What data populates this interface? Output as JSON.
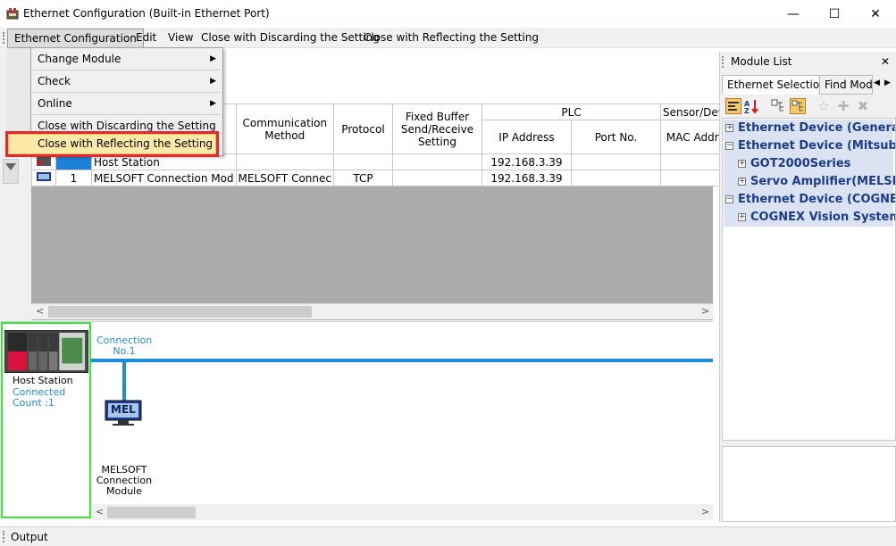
{
  "window": {
    "title": "Ethernet Configuration (Built-in Ethernet Port)",
    "minimize": "—",
    "maximize": "☐",
    "close": "✕"
  },
  "menu": {
    "items": [
      "Ethernet Configuration",
      "Edit",
      "View",
      "Close with Discarding the Setting",
      "Close with Reflecting the Setting"
    ]
  },
  "dropdown": {
    "items": [
      {
        "label": "Change Module",
        "submenu": true
      },
      {
        "label": "Check",
        "submenu": true
      },
      {
        "label": "Online",
        "submenu": true
      },
      {
        "label": "Close with Discarding the Setting",
        "submenu": false
      },
      {
        "label": "Close with Reflecting the Setting",
        "submenu": false
      }
    ],
    "arrow": "▶"
  },
  "grid": {
    "headers": {
      "comm_method": "Communication Method",
      "protocol": "Protocol",
      "fixed_buffer": "Fixed Buffer Send/Receive Setting",
      "plc": "PLC",
      "sensor": "Sensor/Device",
      "ip": "IP Address",
      "port": "Port No.",
      "mac": "MAC Address"
    },
    "rows": [
      {
        "no": "",
        "name": "Host Station",
        "method": "",
        "protocol": "",
        "fixed": "",
        "ip": "192.168.3.39",
        "port": "",
        "mac": ""
      },
      {
        "no": "1",
        "name": "MELSOFT Connection Mod",
        "method": "MELSOFT Connec",
        "protocol": "TCP",
        "fixed": "",
        "ip": "192.168.3.39",
        "port": "",
        "mac": ""
      }
    ]
  },
  "scroll": {
    "left": "<",
    "right": ">"
  },
  "diagram": {
    "connection_label": "Connection No.1",
    "host_label": "Host Station",
    "connected_count": "Connected Count :1",
    "module_label": "MELSOFT Connection Module",
    "mel_text": "MEL"
  },
  "module_list": {
    "title": "Module List",
    "close": "✕",
    "tabs": [
      "Ethernet Selection",
      "Find Mod"
    ],
    "tab_prev": "◀",
    "tab_next": "▶",
    "tree": [
      {
        "label": "Ethernet Device (General)",
        "level": 0,
        "expander": "+"
      },
      {
        "label": "Ethernet Device (Mitsubishi",
        "level": 0,
        "expander": "−"
      },
      {
        "label": "GOT2000Series",
        "level": 1,
        "expander": "+"
      },
      {
        "label": "Servo Amplifier(MELSERV",
        "level": 1,
        "expander": "+"
      },
      {
        "label": "Ethernet Device (COGNEX)",
        "level": 0,
        "expander": "−"
      },
      {
        "label": "COGNEX Vision System",
        "level": 1,
        "expander": "+"
      }
    ]
  },
  "output": {
    "title": "Output"
  },
  "colors": {
    "accent_blue": "#1d8cdb",
    "host_frame": "#34e834",
    "highlight_red": "#e8262d"
  }
}
